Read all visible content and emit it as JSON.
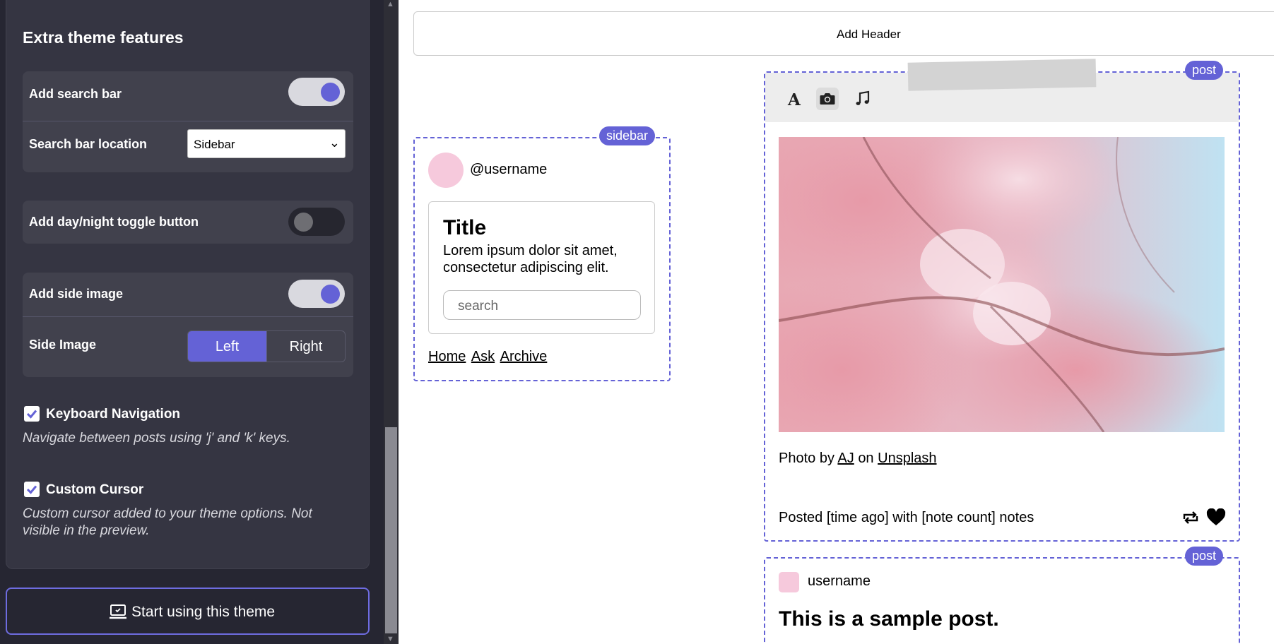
{
  "settings": {
    "section_title": "Extra theme features",
    "search_group": {
      "add_search_bar_label": "Add search bar",
      "add_search_bar_on": true,
      "location_label": "Search bar location",
      "location_value": "Sidebar"
    },
    "day_night_label": "Add day/night toggle button",
    "day_night_on": false,
    "side_image_group": {
      "add_side_image_label": "Add side image",
      "add_side_image_on": true,
      "side_image_label": "Side Image",
      "options": [
        "Left",
        "Right"
      ],
      "selected": "Left"
    },
    "keyboard_nav": {
      "label": "Keyboard Navigation",
      "checked": true,
      "description": "Navigate between posts using 'j' and 'k' keys."
    },
    "custom_cursor": {
      "label": "Custom Cursor",
      "checked": true,
      "description": "Custom cursor added to your theme options. Not visible in the preview."
    },
    "start_button_label": "Start using this theme"
  },
  "preview": {
    "add_header_label": "Add Header",
    "sidebar": {
      "tag": "sidebar",
      "username": "@username",
      "title": "Title",
      "text": "Lorem ipsum dolor sit amet, consectetur adipiscing elit.",
      "search_placeholder": "search",
      "links": [
        "Home",
        "Ask",
        "Archive"
      ]
    },
    "post1": {
      "tag": "post",
      "credit_prefix": "Photo by",
      "credit_author": "AJ",
      "credit_mid": "on",
      "credit_source": "Unsplash",
      "posted_text": "Posted [time ago] with [note count] notes"
    },
    "post2": {
      "tag": "post",
      "username": "username",
      "title": "This is a sample post."
    }
  },
  "colors": {
    "accent": "#6462d6",
    "panel_bg": "#262632",
    "card_bg": "#353542",
    "group_bg": "#41414d",
    "avatar_pink": "#f6c9dc"
  }
}
